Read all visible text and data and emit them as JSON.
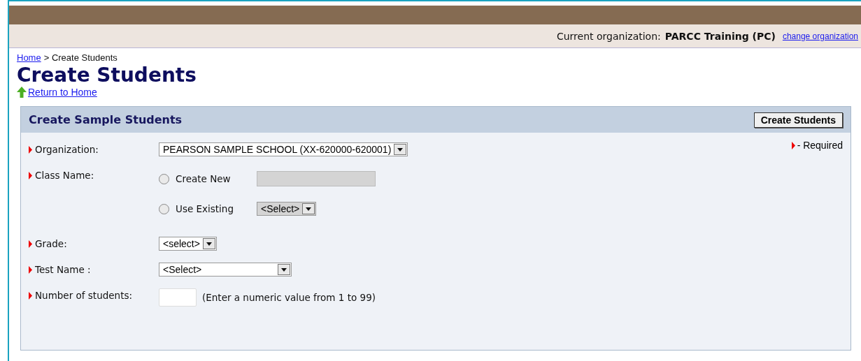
{
  "header": {
    "org_label": "Current organization:",
    "org_name": "PARCC Training (PC)",
    "change_link": "change organization"
  },
  "breadcrumb": {
    "home_link": "Home",
    "current": "> Create Students"
  },
  "title": "Create Students",
  "return_link": "Return to Home",
  "panel": {
    "title": "Create Sample Students",
    "button": "Create Students",
    "required_note": "- Required",
    "fields": [
      {
        "label": "Organization:",
        "kind": "select",
        "value": "PEARSON SAMPLE SCHOOL (XX-620000-620001)"
      },
      {
        "label": "Class Name:",
        "kind": "choice",
        "options": [
          {
            "label": "Create New",
            "selected": false,
            "control": {
              "kind": "text",
              "disabled": true
            }
          },
          {
            "label": "Use Existing",
            "selected": false,
            "control": {
              "kind": "select",
              "value": "<Select>",
              "disabled": true
            }
          }
        ]
      },
      {
        "label": "Grade:",
        "kind": "select",
        "value": "<select>"
      },
      {
        "label": "Test Name :",
        "kind": "long-select",
        "value": "<Select>"
      },
      {
        "label": "Number of students:",
        "kind": "number",
        "hint": "(Enter a numeric value from 1 to 99)"
      }
    ]
  }
}
